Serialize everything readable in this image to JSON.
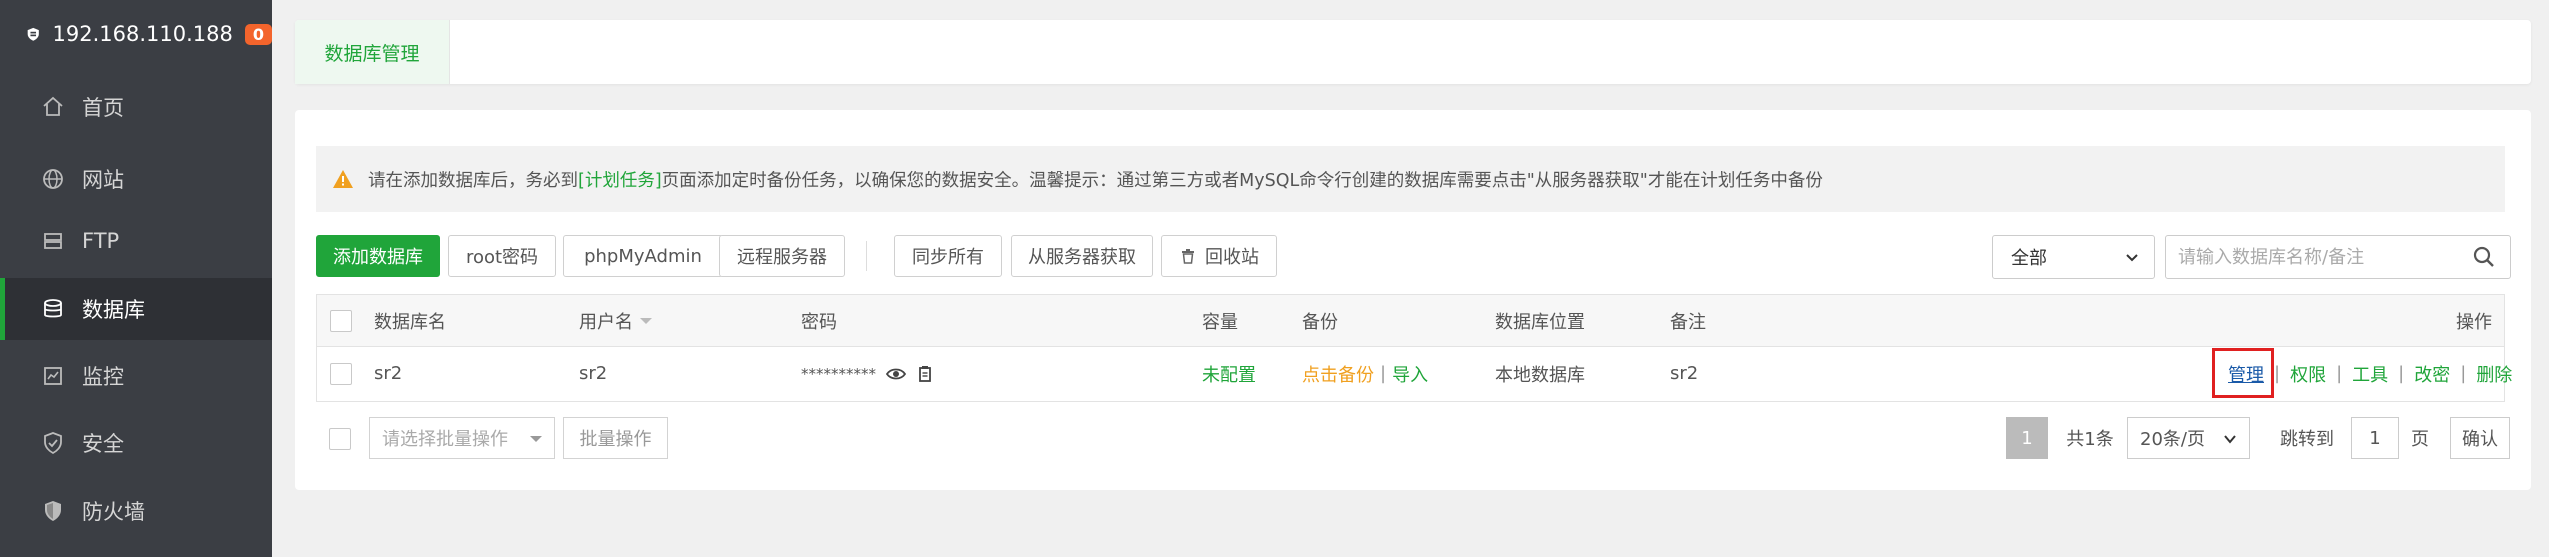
{
  "sidebar": {
    "host": "192.168.110.188",
    "badge": "0",
    "items": [
      {
        "label": "首页",
        "icon": "home-icon"
      },
      {
        "label": "网站",
        "icon": "globe-icon"
      },
      {
        "label": "FTP",
        "icon": "ftp-icon"
      },
      {
        "label": "数据库",
        "icon": "database-icon",
        "active": true
      },
      {
        "label": "监控",
        "icon": "monitor-icon"
      },
      {
        "label": "安全",
        "icon": "shield-check-icon"
      },
      {
        "label": "防火墙",
        "icon": "shield-icon"
      }
    ]
  },
  "tabs": {
    "active": "数据库管理"
  },
  "notice": {
    "before": "请在添加数据库后，务必到",
    "link": "[计划任务]",
    "after": "页面添加定时备份任务，以确保您的数据安全。温馨提示：通过第三方或者MySQL命令行创建的数据库需要点击\"从服务器获取\"才能在计划任务中备份"
  },
  "toolbar": {
    "add": "添加数据库",
    "root_password": "root密码",
    "phpmyadmin": "phpMyAdmin",
    "remote_server": "远程服务器",
    "sync_all": "同步所有",
    "fetch_from_server": "从服务器获取",
    "recycle_bin": "回收站"
  },
  "filter": {
    "selected": "全部"
  },
  "search": {
    "placeholder": "请输入数据库名称/备注"
  },
  "table": {
    "headers": {
      "name": "数据库名",
      "user": "用户名",
      "password": "密码",
      "capacity": "容量",
      "backup": "备份",
      "location": "数据库位置",
      "remark": "备注",
      "actions": "操作"
    },
    "rows": [
      {
        "name": "sr2",
        "user": "sr2",
        "password": "**********",
        "capacity": "未配置",
        "backup_action": "点击备份",
        "import_action": "导入",
        "location": "本地数据库",
        "remark": "sr2",
        "actions": [
          "管理",
          "权限",
          "工具",
          "改密",
          "删除"
        ]
      }
    ]
  },
  "batch": {
    "placeholder": "请选择批量操作",
    "button": "批量操作"
  },
  "pagination": {
    "current": "1",
    "total": "共1条",
    "per_page": "20条/页",
    "goto_label": "跳转到",
    "goto_value": "1",
    "page_unit": "页",
    "confirm": "确认"
  },
  "colors": {
    "accent": "#20a53a",
    "sidebar": "#3b3e44",
    "highlight": "#e02020",
    "badge": "#f3642c"
  }
}
